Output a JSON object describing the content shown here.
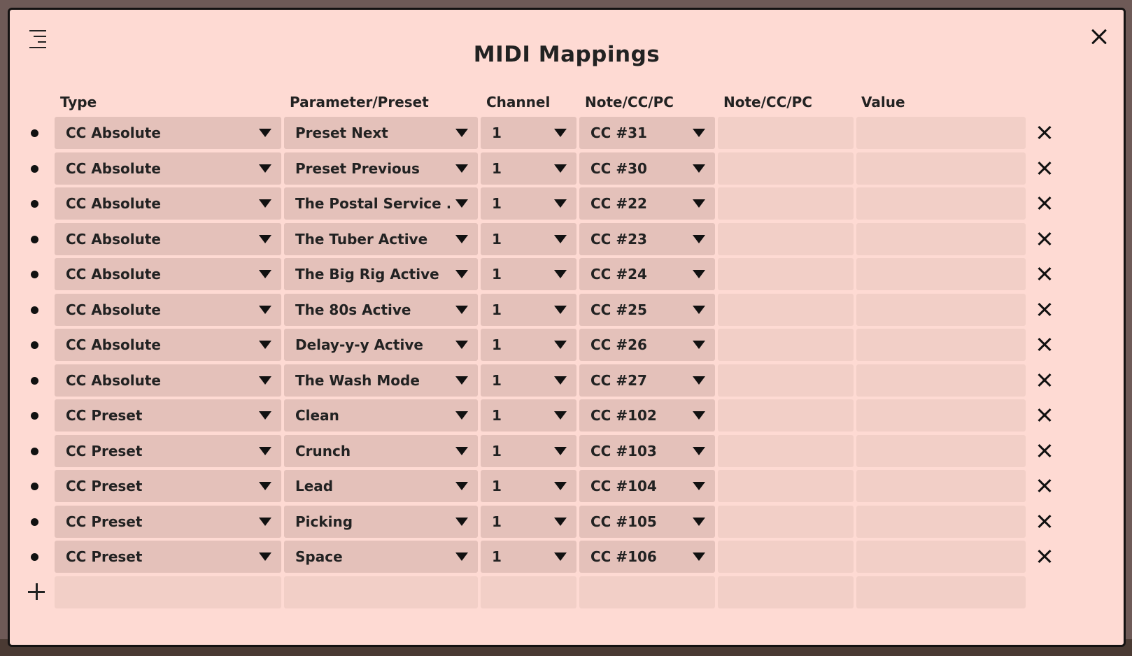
{
  "dialog": {
    "title": "MIDI Mappings"
  },
  "columns": [
    "Type",
    "Parameter/Preset",
    "Channel",
    "Note/CC/PC",
    "Note/CC/PC",
    "Value"
  ],
  "rows": [
    {
      "type": "CC Absolute",
      "param": "Preset Next",
      "channel": "1",
      "cc": "CC #31"
    },
    {
      "type": "CC Absolute",
      "param": "Preset Previous",
      "channel": "1",
      "cc": "CC #30"
    },
    {
      "type": "CC Absolute",
      "param": "The Postal Service ...",
      "channel": "1",
      "cc": "CC #22"
    },
    {
      "type": "CC Absolute",
      "param": "The Tuber Active",
      "channel": "1",
      "cc": "CC #23"
    },
    {
      "type": "CC Absolute",
      "param": "The Big Rig Active",
      "channel": "1",
      "cc": "CC #24"
    },
    {
      "type": "CC Absolute",
      "param": "The 80s Active",
      "channel": "1",
      "cc": "CC #25"
    },
    {
      "type": "CC Absolute",
      "param": "Delay-y-y Active",
      "channel": "1",
      "cc": "CC #26"
    },
    {
      "type": "CC Absolute",
      "param": "The Wash Mode",
      "channel": "1",
      "cc": "CC #27"
    },
    {
      "type": "CC Preset",
      "param": "Clean",
      "channel": "1",
      "cc": "CC #102"
    },
    {
      "type": "CC Preset",
      "param": "Crunch",
      "channel": "1",
      "cc": "CC #103"
    },
    {
      "type": "CC Preset",
      "param": "Lead",
      "channel": "1",
      "cc": "CC #104"
    },
    {
      "type": "CC Preset",
      "param": "Picking",
      "channel": "1",
      "cc": "CC #105"
    },
    {
      "type": "CC Preset",
      "param": "Space",
      "channel": "1",
      "cc": "CC #106"
    }
  ],
  "icons": {
    "menu": "menu-icon",
    "close": "close-icon",
    "delete": "delete-row-icon",
    "add": "add-row-icon",
    "dropdown": "chevron-down-icon",
    "bullet": "row-bullet-icon"
  }
}
